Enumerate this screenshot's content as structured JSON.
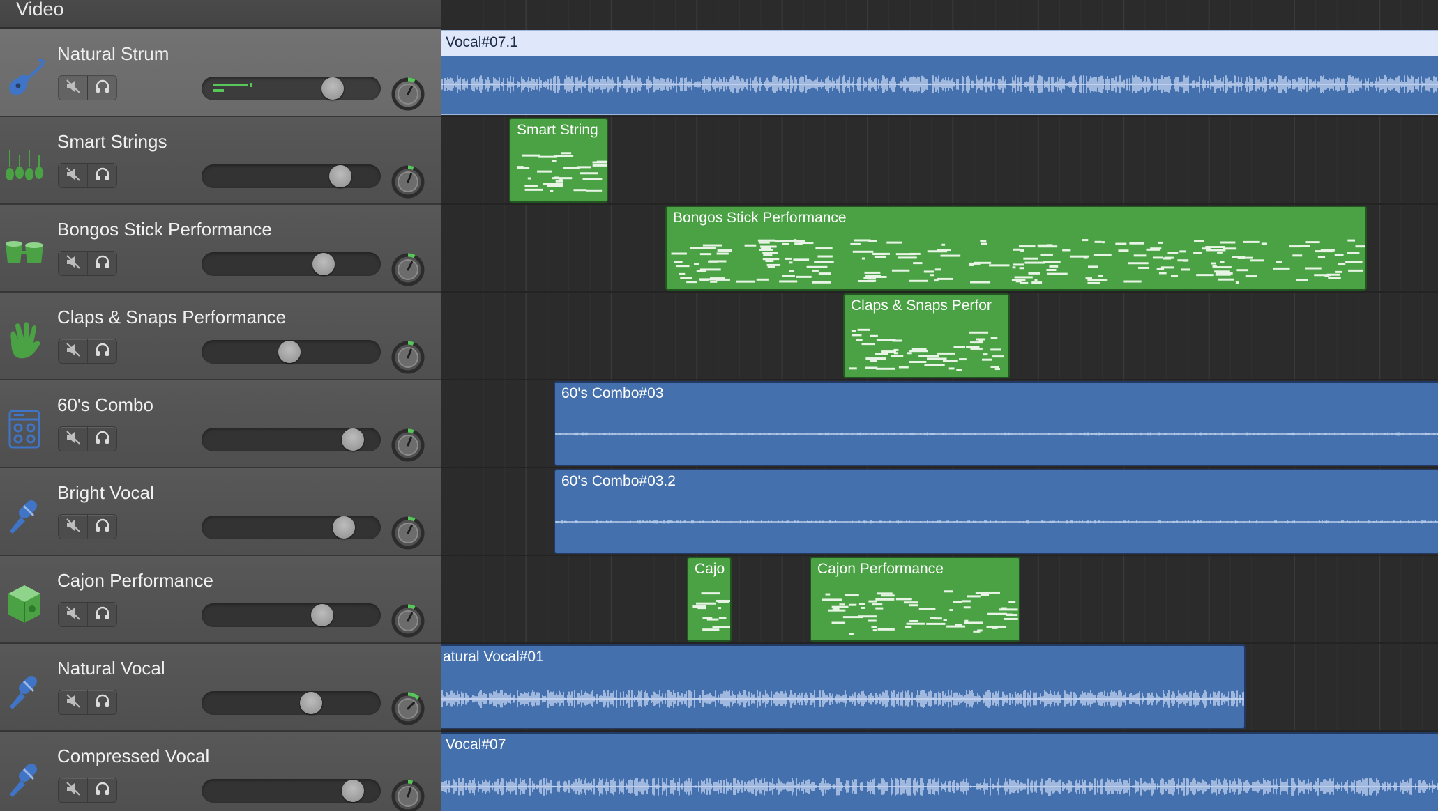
{
  "header": {
    "video_label": "Video"
  },
  "tracks": [
    {
      "name": "Natural Strum",
      "icon": "acoustic-guitar-icon",
      "icon_color": "#3f74c7",
      "selected": true,
      "volume": 0.77,
      "pan_level": 0.15,
      "meter_level": 0.2
    },
    {
      "name": "Smart Strings",
      "icon": "string-instruments-icon",
      "icon_color": "#4aa244",
      "selected": false,
      "volume": 0.82,
      "pan_level": 0.12
    },
    {
      "name": "Bongos Stick Performance",
      "icon": "bongos-icon",
      "icon_color": "#4aa244",
      "selected": false,
      "volume": 0.71,
      "pan_level": 0.15
    },
    {
      "name": "Claps & Snaps Performance",
      "icon": "clapping-hand-icon",
      "icon_color": "#4aa244",
      "selected": false,
      "volume": 0.49,
      "pan_level": 0.12
    },
    {
      "name": "60's Combo",
      "icon": "amplifier-icon",
      "icon_color": "#3f74c7",
      "selected": false,
      "volume": 0.9,
      "pan_level": 0.12
    },
    {
      "name": "Bright Vocal",
      "icon": "microphone-icon",
      "icon_color": "#3f74c7",
      "selected": false,
      "volume": 0.84,
      "pan_level": 0.15
    },
    {
      "name": "Cajon Performance",
      "icon": "cajon-box-icon",
      "icon_color": "#4aa244",
      "selected": false,
      "volume": 0.7,
      "pan_level": 0.15
    },
    {
      "name": "Natural Vocal",
      "icon": "microphone-icon",
      "icon_color": "#3f74c7",
      "selected": false,
      "volume": 0.63,
      "pan_level": 0.25
    },
    {
      "name": "Compressed Vocal",
      "icon": "microphone-icon",
      "icon_color": "#3f74c7",
      "selected": false,
      "volume": 0.9,
      "pan_level": 0.1
    }
  ],
  "regions": [
    {
      "track": 0,
      "label": "Vocal#07.1",
      "kind": "audio",
      "selected": true
    },
    {
      "track": 1,
      "label": "Smart String",
      "kind": "midi"
    },
    {
      "track": 2,
      "label": "Bongos Stick Performance",
      "kind": "midi"
    },
    {
      "track": 3,
      "label": "Claps & Snaps Perfor",
      "kind": "midi"
    },
    {
      "track": 4,
      "label": "60's Combo#03",
      "kind": "audio"
    },
    {
      "track": 5,
      "label": "60's Combo#03.2",
      "kind": "audio"
    },
    {
      "track": 6,
      "label": "Cajo",
      "kind": "midi"
    },
    {
      "track": 6,
      "label": "Cajon Performance",
      "kind": "midi"
    },
    {
      "track": 7,
      "label": "atural Vocal#01",
      "kind": "audio"
    },
    {
      "track": 8,
      "label": "Vocal#07",
      "kind": "audio"
    }
  ],
  "colors": {
    "audio_region": "#4470ad",
    "midi_region": "#4aa244",
    "accent_green": "#57c75a"
  }
}
